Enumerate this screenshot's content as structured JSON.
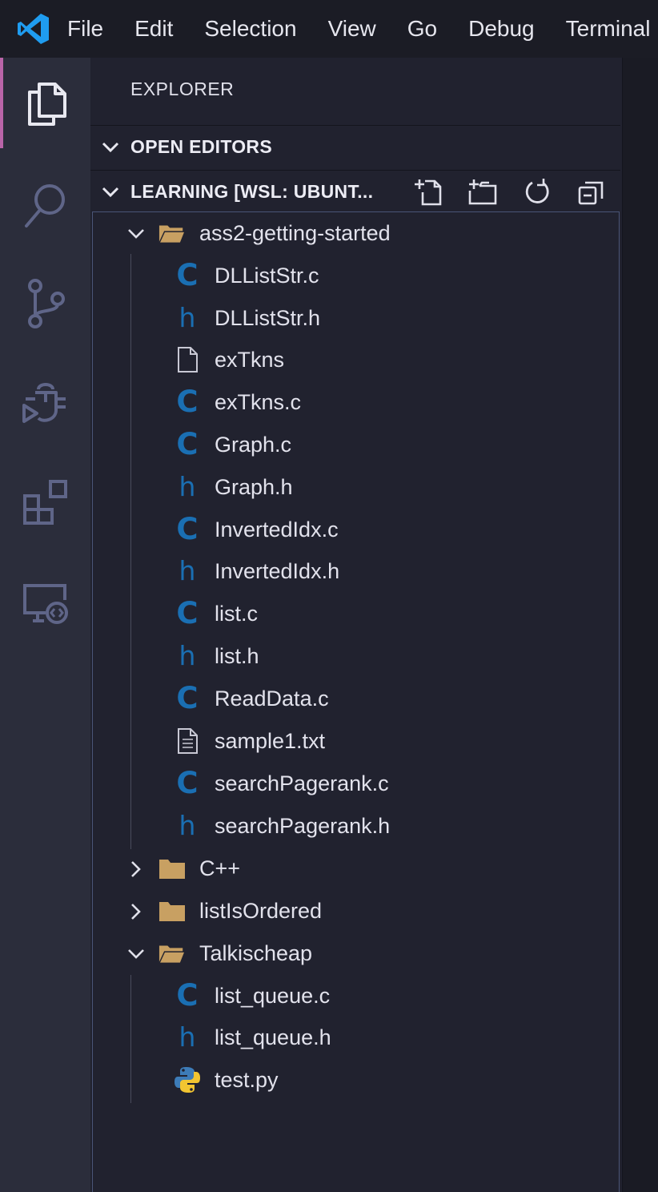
{
  "menu": [
    "File",
    "Edit",
    "Selection",
    "View",
    "Go",
    "Debug",
    "Terminal"
  ],
  "sidebar": {
    "title": "EXPLORER",
    "open_editors": "OPEN EDITORS",
    "workspace": "LEARNING [WSL: UBUNT..."
  },
  "tree": {
    "folders": {
      "ass2": "ass2-getting-started",
      "cpp": "C++",
      "list_is_ordered": "listIsOrdered",
      "talk": "Talkischeap"
    },
    "ass2_files": [
      "DLListStr.c",
      "DLListStr.h",
      "exTkns",
      "exTkns.c",
      "Graph.c",
      "Graph.h",
      "InvertedIdx.c",
      "InvertedIdx.h",
      "list.c",
      "list.h",
      "ReadData.c",
      "sample1.txt",
      "searchPagerank.c",
      "searchPagerank.h"
    ],
    "talk_files": [
      "list_queue.c",
      "list_queue.h",
      "test.py"
    ]
  },
  "icons": {
    "c_glyph": "C",
    "h_glyph": "h"
  },
  "colors": {
    "accent": "#b964a8",
    "c_file": "#1a6fb3",
    "folder": "#c8a062"
  }
}
